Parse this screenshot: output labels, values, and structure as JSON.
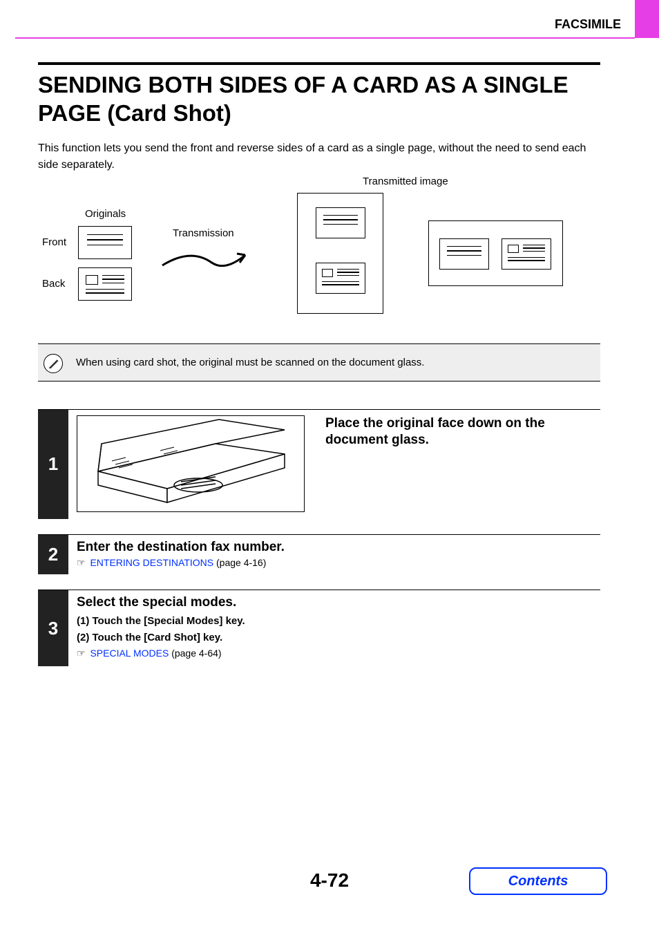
{
  "section_label": "FACSIMILE",
  "page_title": "SENDING BOTH SIDES OF A CARD AS A SINGLE PAGE (Card Shot)",
  "intro": "This function lets you send the front and reverse sides of a card as a single page, without the need to send each side separately.",
  "diagram": {
    "originals": "Originals",
    "front": "Front",
    "back": "Back",
    "transmission": "Transmission",
    "transmitted": "Transmitted image"
  },
  "note": "When using card shot, the original must be scanned on the document glass.",
  "steps": [
    {
      "num": "1",
      "heading": "Place the original face down on the document glass."
    },
    {
      "num": "2",
      "heading": "Enter the destination fax number.",
      "link_text": "ENTERING DESTINATIONS",
      "link_page": " (page 4-16)"
    },
    {
      "num": "3",
      "heading": "Select the special modes.",
      "substeps": [
        "(1)   Touch the [Special Modes] key.",
        "(2)   Touch the [Card Shot] key."
      ],
      "link_text": "SPECIAL MODES",
      "link_page": " (page 4-64)"
    }
  ],
  "page_number": "4-72",
  "contents_button": "Contents"
}
